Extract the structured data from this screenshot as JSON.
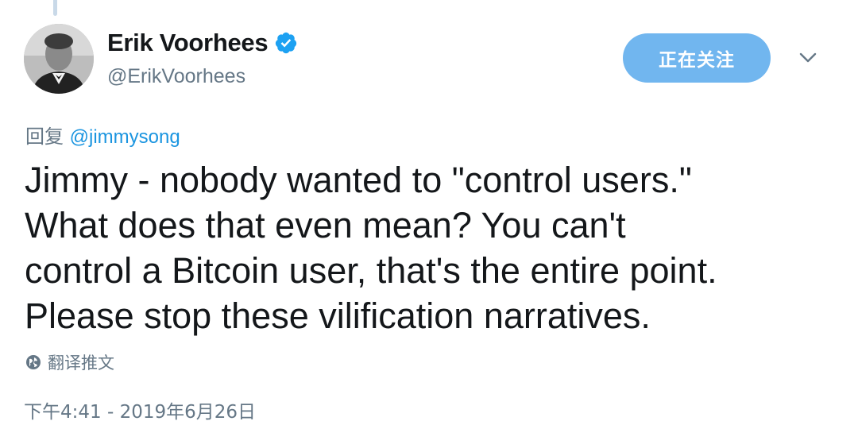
{
  "author": {
    "display_name": "Erik Voorhees",
    "handle": "@ErikVoorhees",
    "verified": true
  },
  "follow_button": {
    "label": "正在关注"
  },
  "reply_to": {
    "prefix": "回复 ",
    "mention": "@jimmysong"
  },
  "tweet": {
    "text": "Jimmy - nobody wanted to \"control users.\"\nWhat does that even mean? You can't\ncontrol a Bitcoin user, that's the entire point.\nPlease stop these vilification narratives."
  },
  "translate": {
    "label": "翻译推文"
  },
  "timestamp": "下午4:41 - 2019年6月26日",
  "colors": {
    "accent": "#1da1f2",
    "follow_button_bg": "#71b6ef",
    "mention": "#1b95e0",
    "secondary_text": "#657786",
    "primary_text": "#14171a"
  },
  "icons": {
    "verified": "verified-badge-icon",
    "caret": "chevron-down-icon",
    "translate": "globe-icon"
  }
}
